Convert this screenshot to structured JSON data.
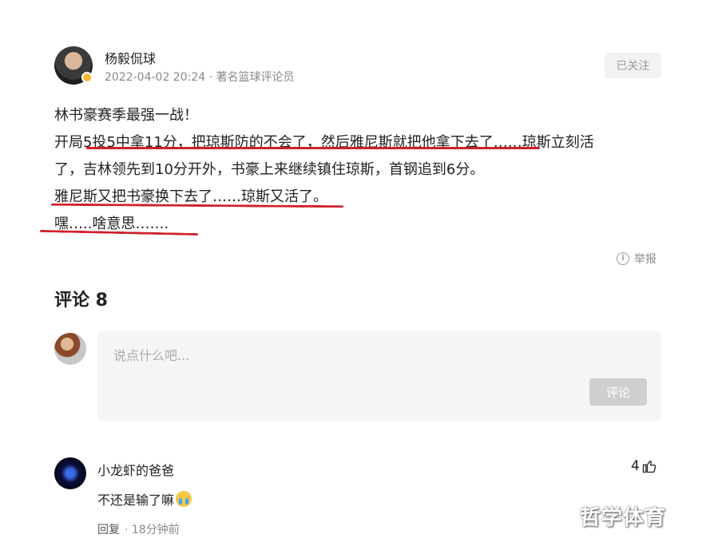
{
  "author": {
    "name": "杨毅侃球",
    "meta": "2022-04-02 20:24 · 著名篮球评论员",
    "follow_label": "已关注"
  },
  "post": {
    "lines": [
      "林书豪赛季最强一战！",
      "开局5投5中拿11分，把琼斯防的不会了，然后雅尼斯就把他拿下去了……琼斯立刻活",
      "了，吉林领先到10分开外，书豪上来继续镇住琼斯，首钢追到6分。",
      "雅尼斯又把书豪换下去了……琼斯又活了。",
      "嘿…..啥意思……."
    ],
    "underline_color": "#d0202a"
  },
  "report_label": "举报",
  "comments": {
    "title": "评论 8",
    "input_placeholder": "说点什么吧...",
    "submit_label": "评论",
    "items": [
      {
        "name": "小龙虾的爸爸",
        "likes": "4",
        "text": "不还是输了嘛",
        "reply_label": "回复",
        "time": "· 18分钟前"
      }
    ]
  },
  "watermark": "哲学体育",
  "icons": {
    "report": "info-icon",
    "like": "thumb-up-icon",
    "emoji": "crying-emoji-icon",
    "verified": "verified-badge-icon"
  }
}
